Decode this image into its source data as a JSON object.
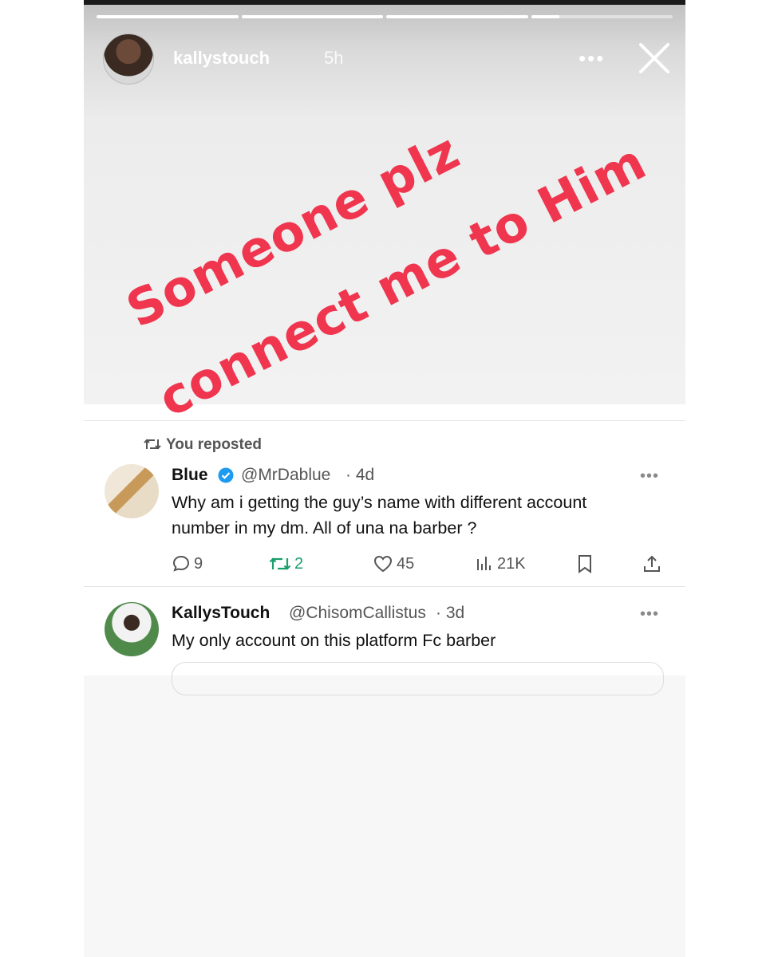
{
  "story": {
    "username": "kallystouch",
    "time": "5h",
    "more_label": "•••",
    "progress": [
      1,
      1,
      1,
      0.2
    ],
    "overlay": {
      "line1": "Someone plz",
      "line2": "connect me to Him",
      "color": "#f0364f"
    }
  },
  "reposted_label": "You reposted",
  "tweet": {
    "name": "Blue",
    "handle": "@MrDablue",
    "time": "· 4d",
    "verified": true,
    "more_label": "•••",
    "text_line1": "Why am i getting the guy’s name with different account",
    "text_line2": "number in my dm. All of una na barber ?",
    "replies": "9",
    "reposts": "2",
    "likes": "45",
    "views": "21K"
  },
  "reply": {
    "name": "KallysTouch",
    "handle": "@ChisomCallistus",
    "time": "· 3d",
    "more_label": "•••",
    "text": "My only account on this platform Fc barber"
  },
  "colors": {
    "accent_verified": "#1d9bf0",
    "repost_green": "#1a9e6a",
    "overlay_red": "#f0364f"
  }
}
